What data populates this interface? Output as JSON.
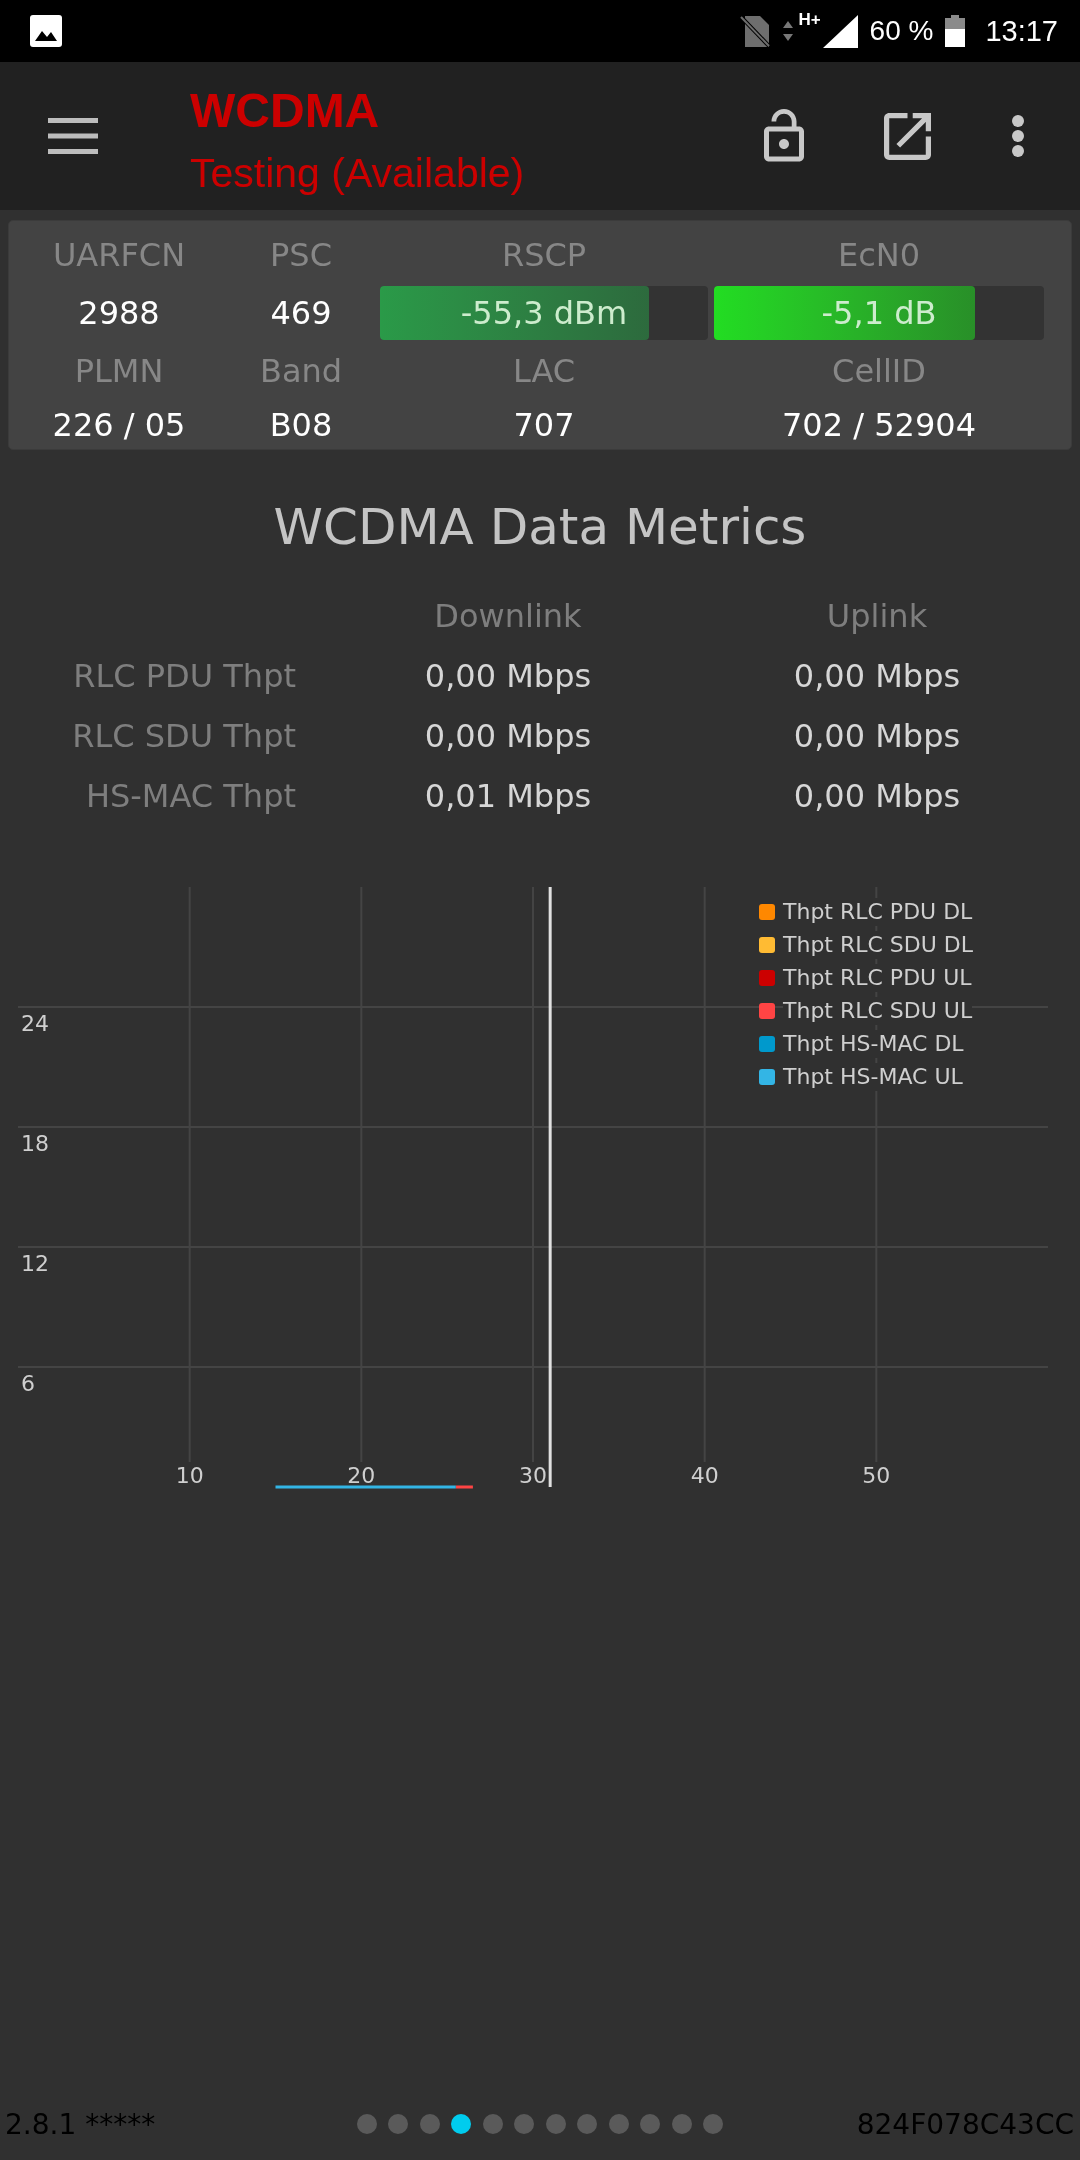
{
  "status_bar": {
    "network_type": "H+",
    "battery": "60 %",
    "time": "13:17"
  },
  "toolbar": {
    "title": "WCDMA",
    "subtitle": "Testing (Available)"
  },
  "cell_info": {
    "fields": [
      {
        "kind": "text",
        "label": "UARFCN",
        "value": "2988"
      },
      {
        "kind": "text",
        "label": "PSC",
        "value": "469"
      },
      {
        "kind": "meter",
        "label": "RSCP",
        "value": "-55,3 dBm",
        "level": 0.82,
        "color": "#2a9a48"
      },
      {
        "kind": "meter",
        "label": "EcN0",
        "value": "-5,1 dB",
        "level": 0.79,
        "color": "#22dd22"
      },
      {
        "kind": "text",
        "label": "PLMN",
        "value": "226 / 05"
      },
      {
        "kind": "text",
        "label": "Band",
        "value": "B08"
      },
      {
        "kind": "text",
        "label": "LAC",
        "value": "707"
      },
      {
        "kind": "text",
        "label": "CellID",
        "value": "702 / 52904"
      }
    ]
  },
  "data_metrics": {
    "title": "WCDMA Data Metrics",
    "columns": [
      "Downlink",
      "Uplink"
    ],
    "rows": [
      {
        "label": "RLC PDU Thpt",
        "values": [
          "0,00 Mbps",
          "0,00 Mbps"
        ]
      },
      {
        "label": "RLC SDU Thpt",
        "values": [
          "0,00 Mbps",
          "0,00 Mbps"
        ]
      },
      {
        "label": "HS-MAC Thpt",
        "values": [
          "0,01 Mbps",
          "0,00 Mbps"
        ]
      }
    ],
    "chart_data": {
      "type": "line",
      "x": [
        15,
        25.5,
        26.5
      ],
      "series": [
        {
          "name": "Thpt RLC PDU DL",
          "color": "#ff8800",
          "values": [
            null,
            null,
            null
          ]
        },
        {
          "name": "Thpt RLC SDU DL",
          "color": "#ffbb33",
          "values": [
            null,
            null,
            null
          ]
        },
        {
          "name": "Thpt RLC PDU UL",
          "color": "#cc0000",
          "values": [
            null,
            null,
            null
          ]
        },
        {
          "name": "Thpt RLC SDU UL",
          "color": "#ff4444",
          "values": [
            null,
            0,
            0
          ]
        },
        {
          "name": "Thpt HS-MAC DL",
          "color": "#0099cc",
          "values": [
            null,
            null,
            null
          ]
        },
        {
          "name": "Thpt HS-MAC UL",
          "color": "#33b5e5",
          "values": [
            0,
            0,
            null
          ]
        }
      ],
      "xlim": [
        0,
        60
      ],
      "ylim": [
        0,
        30
      ],
      "xticks": [
        10,
        20,
        30,
        40,
        50
      ],
      "yticks": [
        6,
        12,
        18,
        24
      ],
      "grid": true,
      "legend": "upper right",
      "ref_lines": [
        {
          "axis": "x",
          "value": 31
        }
      ]
    }
  },
  "footer": {
    "version": "2.8.1 *****",
    "pages": [
      {
        "selected": false
      },
      {
        "selected": false
      },
      {
        "selected": false
      },
      {
        "selected": true
      },
      {
        "selected": false
      },
      {
        "selected": false
      },
      {
        "selected": false
      },
      {
        "selected": false
      },
      {
        "selected": false
      },
      {
        "selected": false
      },
      {
        "selected": false
      },
      {
        "selected": false
      }
    ],
    "device_id": "824F078C43CC"
  }
}
